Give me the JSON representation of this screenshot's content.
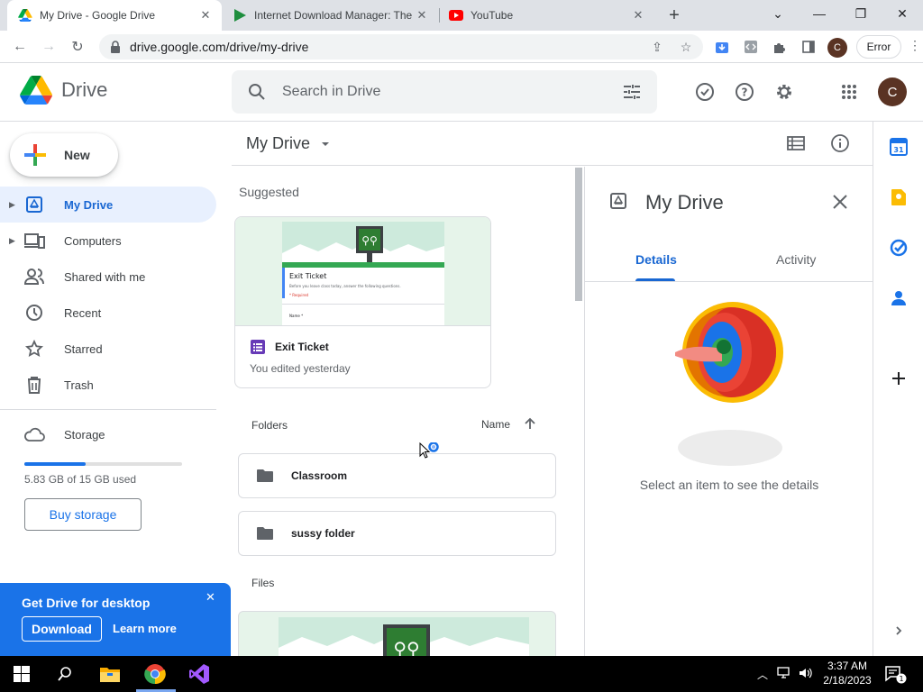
{
  "browser": {
    "tabs": [
      {
        "title": "My Drive - Google Drive",
        "icon": "google-drive-icon",
        "active": true
      },
      {
        "title": "Internet Download Manager: The",
        "icon": "idm-icon",
        "active": false
      },
      {
        "title": "YouTube",
        "icon": "youtube-icon",
        "active": false
      }
    ],
    "url": "drive.google.com/drive/my-drive",
    "profile_initial": "C",
    "error_label": "Error"
  },
  "header": {
    "app_name": "Drive",
    "search_placeholder": "Search in Drive",
    "avatar_initial": "C"
  },
  "sidebar": {
    "new_label": "New",
    "items": [
      {
        "label": "My Drive",
        "icon": "my-drive-icon",
        "active": true,
        "expandable": true
      },
      {
        "label": "Computers",
        "icon": "computers-icon",
        "active": false,
        "expandable": true
      },
      {
        "label": "Shared with me",
        "icon": "shared-icon",
        "active": false,
        "expandable": false
      },
      {
        "label": "Recent",
        "icon": "clock-icon",
        "active": false,
        "expandable": false
      },
      {
        "label": "Starred",
        "icon": "star-icon",
        "active": false,
        "expandable": false
      },
      {
        "label": "Trash",
        "icon": "trash-icon",
        "active": false,
        "expandable": false
      }
    ],
    "storage_label": "Storage",
    "storage_used_text": "5.83 GB of 15 GB used",
    "storage_fraction": 0.389,
    "buy_storage_label": "Buy storage",
    "promo": {
      "title": "Get Drive for desktop",
      "download_label": "Download",
      "learn_more_label": "Learn more"
    }
  },
  "main": {
    "title": "My Drive",
    "suggested_label": "Suggested",
    "suggested": {
      "name": "Exit Ticket",
      "subtitle": "You edited yesterday",
      "thumb_heading": "Exit Ticket",
      "thumb_line": "Before you leave class today, answer the following questions.",
      "thumb_required": "* Required",
      "thumb_field": "Name *"
    },
    "folders_label": "Folders",
    "sort_label": "Name",
    "folders": [
      {
        "name": "Classroom"
      },
      {
        "name": "sussy folder"
      }
    ],
    "files_label": "Files"
  },
  "details": {
    "title": "My Drive",
    "tabs": [
      "Details",
      "Activity"
    ],
    "empty_message": "Select an item to see the details"
  },
  "taskbar": {
    "time": "3:37 AM",
    "date": "2/18/2023",
    "notification_count": "1"
  },
  "colors": {
    "accent": "#1a73e8",
    "active_nav_bg": "#e8f0fe",
    "avatar_bg": "#5a3323"
  }
}
